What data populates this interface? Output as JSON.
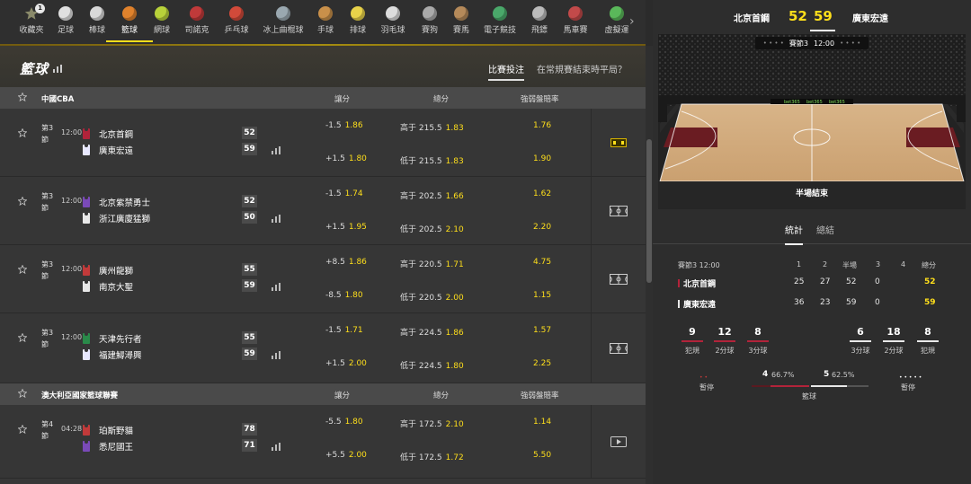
{
  "nav": {
    "items": [
      {
        "label": "收藏夾",
        "icon": "star-icon",
        "color": "#8a8a8a",
        "badge": "1"
      },
      {
        "label": "足球",
        "icon": "soccer-icon",
        "color": "#e0e0e0"
      },
      {
        "label": "棒球",
        "icon": "baseball-icon",
        "color": "#d9d9d9"
      },
      {
        "label": "籃球",
        "icon": "basketball-icon",
        "color": "#e0822c",
        "active": true
      },
      {
        "label": "網球",
        "icon": "tennis-icon",
        "color": "#b8d23a"
      },
      {
        "label": "司諾克",
        "icon": "snooker-icon",
        "color": "#c03a3a"
      },
      {
        "label": "乒乓球",
        "icon": "table-tennis-icon",
        "color": "#d24a3a"
      },
      {
        "label": "冰上曲棍球",
        "icon": "ice-hockey-icon",
        "color": "#9aa8b0"
      },
      {
        "label": "手球",
        "icon": "handball-icon",
        "color": "#c9904a"
      },
      {
        "label": "排球",
        "icon": "volleyball-icon",
        "color": "#e8d24a"
      },
      {
        "label": "羽毛球",
        "icon": "badminton-icon",
        "color": "#dddddd"
      },
      {
        "label": "賽狗",
        "icon": "greyhound-icon",
        "color": "#aaaaaa"
      },
      {
        "label": "賽馬",
        "icon": "horse-racing-icon",
        "color": "#b58a5a"
      },
      {
        "label": "電子競技",
        "icon": "esports-icon",
        "color": "#4aa86a"
      },
      {
        "label": "飛鏢",
        "icon": "darts-icon",
        "color": "#bbbbbb"
      },
      {
        "label": "馬車賽",
        "icon": "harness-icon",
        "color": "#c24a4a"
      },
      {
        "label": "虛擬運",
        "icon": "virtual-icon",
        "color": "#5ab85a"
      }
    ]
  },
  "page": {
    "title": "籃球",
    "tab_bet": "比賽投注",
    "tab_tie": "在常規賽結束時平局？"
  },
  "columns": {
    "handicap": "讓分",
    "total": "總分",
    "moneyline": "強弱盤賠率"
  },
  "leagues": [
    {
      "name": "中國CBA",
      "matches": [
        {
          "period": "第3節",
          "clock": "12:00",
          "home": {
            "name": "北京首鋼",
            "score": "52",
            "color": "#b2233a"
          },
          "away": {
            "name": "廣東宏遠",
            "score": "59",
            "color": "#e8e8ff"
          },
          "hcp": [
            {
              "line": "-1.5",
              "odds": "1.86"
            },
            {
              "line": "+1.5",
              "odds": "1.80"
            }
          ],
          "tot": [
            {
              "line": "高于 215.5",
              "odds": "1.83"
            },
            {
              "line": "低于 215.5",
              "odds": "1.83"
            }
          ],
          "ml": [
            "1.76",
            "1.90"
          ],
          "media": "scoreboard-icon"
        },
        {
          "period": "第3節",
          "clock": "12:00",
          "home": {
            "name": "北京紫禁勇士",
            "score": "52",
            "color": "#7a4ab8"
          },
          "away": {
            "name": "浙江廣廈猛獅",
            "score": "50",
            "color": "#e8e8e8"
          },
          "hcp": [
            {
              "line": "-1.5",
              "odds": "1.74"
            },
            {
              "line": "+1.5",
              "odds": "1.95"
            }
          ],
          "tot": [
            {
              "line": "高于 202.5",
              "odds": "1.66"
            },
            {
              "line": "低于 202.5",
              "odds": "2.10"
            }
          ],
          "ml": [
            "1.62",
            "2.20"
          ],
          "media": "court-icon"
        },
        {
          "period": "第3節",
          "clock": "12:00",
          "home": {
            "name": "廣州龍獅",
            "score": "55",
            "color": "#c23a3a"
          },
          "away": {
            "name": "南京大聖",
            "score": "59",
            "color": "#e8e8e8"
          },
          "hcp": [
            {
              "line": "+8.5",
              "odds": "1.86"
            },
            {
              "line": "-8.5",
              "odds": "1.80"
            }
          ],
          "tot": [
            {
              "line": "高于 220.5",
              "odds": "1.71"
            },
            {
              "line": "低于 220.5",
              "odds": "2.00"
            }
          ],
          "ml": [
            "4.75",
            "1.15"
          ],
          "media": "court-icon"
        },
        {
          "period": "第3節",
          "clock": "12:00",
          "home": {
            "name": "天津先行者",
            "score": "55",
            "color": "#2a8a4a"
          },
          "away": {
            "name": "福建鱘潯興",
            "score": "59",
            "color": "#e8e8ff"
          },
          "hcp": [
            {
              "line": "-1.5",
              "odds": "1.71"
            },
            {
              "line": "+1.5",
              "odds": "2.00"
            }
          ],
          "tot": [
            {
              "line": "高于 224.5",
              "odds": "1.86"
            },
            {
              "line": "低于 224.5",
              "odds": "1.80"
            }
          ],
          "ml": [
            "1.57",
            "2.25"
          ],
          "media": "court-icon"
        }
      ]
    },
    {
      "name": "澳大利亞國家籃球聯賽",
      "matches": [
        {
          "period": "第4節",
          "clock": "04:28",
          "home": {
            "name": "珀斯野貓",
            "score": "78",
            "color": "#c23a3a"
          },
          "away": {
            "name": "悉尼國王",
            "score": "71",
            "color": "#7a4ab8"
          },
          "hcp": [
            {
              "line": "-5.5",
              "odds": "1.80"
            },
            {
              "line": "+5.5",
              "odds": "2.00"
            }
          ],
          "tot": [
            {
              "line": "高于 172.5",
              "odds": "2.10"
            },
            {
              "line": "低于 172.5",
              "odds": "1.72"
            }
          ],
          "ml": [
            "1.14",
            "5.50"
          ],
          "media": "video-icon"
        }
      ]
    }
  ],
  "right": {
    "team1": "北京首鋼",
    "team2": "廣東宏遠",
    "score1": "52",
    "score2": "59",
    "pill": {
      "period": "賽節3",
      "clock": "12:00"
    },
    "court_status": "半場結束",
    "court_ads": [
      "bet365",
      "bet365",
      "bet365"
    ],
    "tab_stats": "統計",
    "tab_summary": "總結",
    "table": {
      "headers": {
        "label": "賽節3  12:00",
        "q1": "1",
        "q2": "2",
        "half": "半場",
        "q3": "3",
        "q4": "4",
        "total": "總分"
      },
      "rows": [
        {
          "name": "北京首鋼",
          "q1": "25",
          "q2": "27",
          "half": "52",
          "q3": "0",
          "q4": "",
          "total": "52",
          "color": "#b2233a"
        },
        {
          "name": "廣東宏遠",
          "q1": "36",
          "q2": "23",
          "half": "59",
          "q3": "0",
          "q4": "",
          "total": "59",
          "color": "#e8e8e8"
        }
      ]
    },
    "stats_left": [
      {
        "n": "9",
        "label": "犯規"
      },
      {
        "n": "12",
        "label": "2分球"
      },
      {
        "n": "8",
        "label": "3分球"
      }
    ],
    "stats_right": [
      {
        "n": "6",
        "label": "3分球"
      },
      {
        "n": "18",
        "label": "2分球"
      },
      {
        "n": "8",
        "label": "犯規"
      }
    ],
    "timeout_left": {
      "label": "暫停",
      "dots": "• •"
    },
    "timeout_right": {
      "label": "暫停",
      "dots": "• • • • •"
    },
    "rebound": {
      "label": "籃球",
      "left_n": "4",
      "left_pct": "66.7%",
      "right_n": "5",
      "right_pct": "62.5%",
      "left_frac": 0.667,
      "right_frac": 0.625
    },
    "accent": "#ffdf1b",
    "team1_color": "#b2233a",
    "team2_color": "#e8e8e8"
  }
}
